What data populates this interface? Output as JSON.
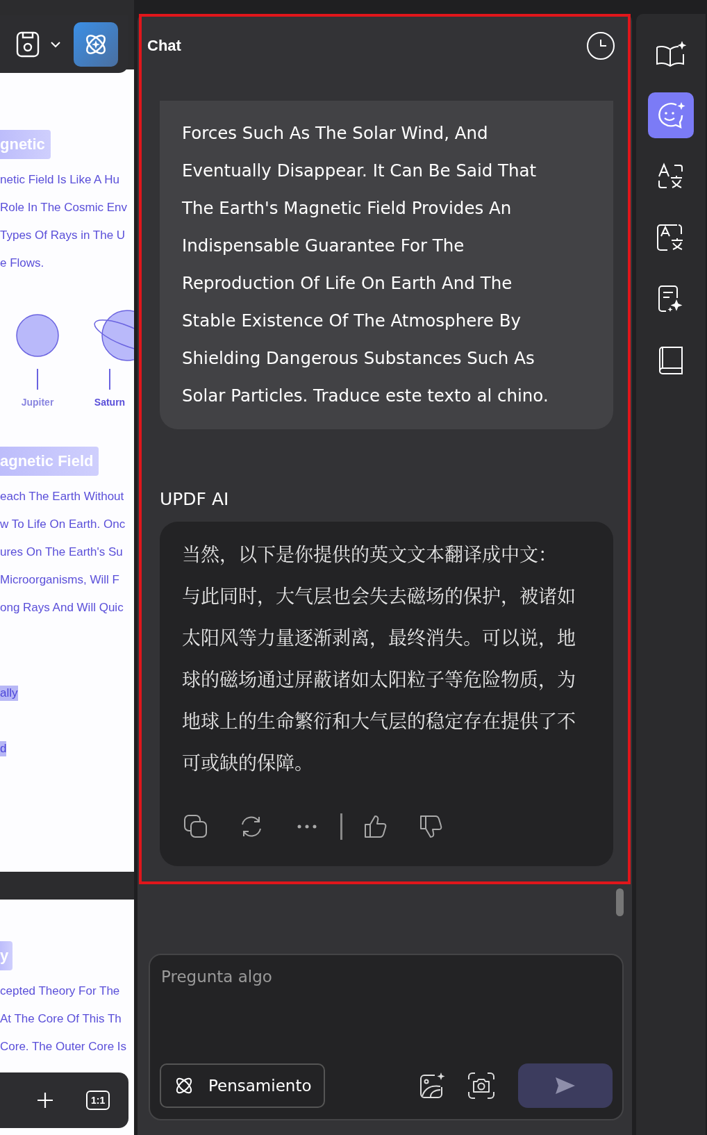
{
  "document": {
    "page_1": {
      "heading_1": "gnetic",
      "lines_1": [
        "netic Field Is Like A Hu",
        "Role In The Cosmic Env",
        "Types Of Rays in The U",
        "e Flows."
      ],
      "planets": [
        {
          "kind": "plain",
          "label": "Jupiter"
        },
        {
          "kind": "ringed",
          "label": "Saturn"
        }
      ],
      "heading_2": "agnetic Field",
      "lines_2": [
        "each The Earth Without",
        "w To Life On Earth. Onc",
        "ures On The Earth's Su",
        " Microorganisms, Will F",
        "ong Rays And Will Quic"
      ],
      "highlights": [
        "ally",
        "d"
      ]
    },
    "page_2": {
      "heading": "y",
      "lines": [
        "cepted Theory For The",
        "At The Core Of This Th",
        "Core. The Outer Core Is"
      ]
    },
    "bottom_toolbar": {
      "fit_button": "1:1"
    }
  },
  "chat": {
    "title": "Chat",
    "messages": [
      {
        "kind": "user",
        "text": "Forces Such As The Solar Wind, And\nEventually Disappear. It Can Be Said That\nThe Earth's Magnetic Field Provides An\nIndispensable Guarantee For The\nReproduction Of Life On Earth And The\nStable Existence Of The Atmosphere By\nShielding Dangerous Substances Such As\nSolar Particles. Traduce este texto al chino."
      },
      {
        "kind": "assistant",
        "sender": "UPDF AI",
        "paragraphs": [
          "当然，以下是你提供的英文文本翻译成中文：",
          "与此同时，大气层也会失去磁场的保护，被诸如太阳风等力量逐渐剥离，最终消失。可以说，地球的磁场通过屏蔽诸如太阳粒子等危险物质，为地球上的生命繁衍和大气层的稳定存在提供了不可或缺的保障。"
        ]
      }
    ],
    "input": {
      "placeholder": "Pregunta algo",
      "thinking_button": "Pensamiento"
    }
  },
  "sidebar": {
    "items": [
      {
        "kind": "book-sparkle",
        "selected": false
      },
      {
        "kind": "chat",
        "selected": true
      },
      {
        "kind": "translate",
        "selected": false
      },
      {
        "kind": "translate-box",
        "selected": false
      },
      {
        "kind": "summary",
        "selected": false
      },
      {
        "kind": "book",
        "selected": false
      }
    ]
  }
}
